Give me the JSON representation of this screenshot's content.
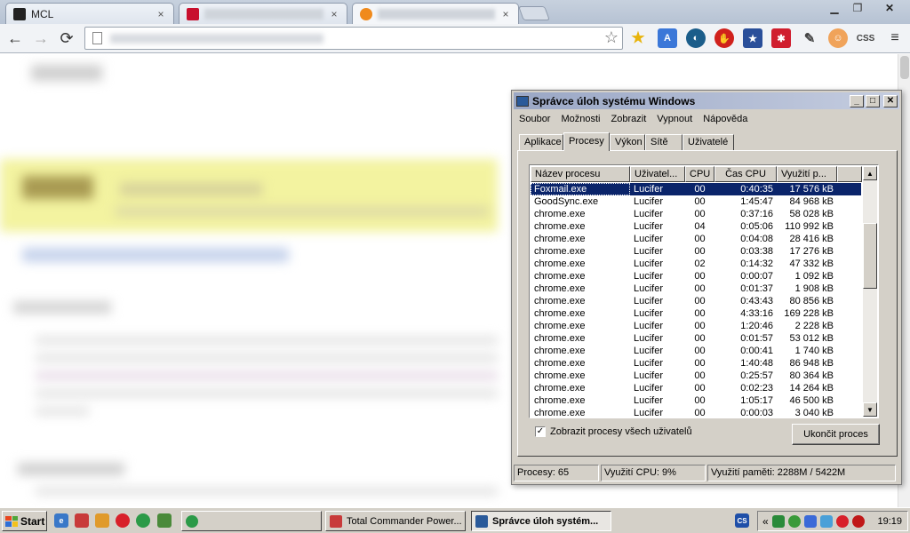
{
  "browser": {
    "tabs": [
      {
        "title": "MCL",
        "icon": "dark-square-icon"
      },
      {
        "title": "",
        "icon": "pnet-favicon"
      },
      {
        "title": "",
        "icon": "fish-favicon"
      }
    ],
    "close_glyph": "×"
  },
  "taskmanager": {
    "title": "Správce úloh systému Windows",
    "menu": [
      "Soubor",
      "Možnosti",
      "Zobrazit",
      "Vypnout",
      "Nápověda"
    ],
    "tabs": [
      "Aplikace",
      "Procesy",
      "Výkon",
      "Sítě",
      "Uživatelé"
    ],
    "active_tab": "Procesy",
    "columns": [
      "Název procesu",
      "Uživatel...",
      "CPU",
      "Čas CPU",
      "Využití p..."
    ],
    "rows": [
      [
        "Foxmail.exe",
        "Lucifer",
        "00",
        "0:40:35",
        "17 576 kB"
      ],
      [
        "GoodSync.exe",
        "Lucifer",
        "00",
        "1:45:47",
        "84 968 kB"
      ],
      [
        "chrome.exe",
        "Lucifer",
        "00",
        "0:37:16",
        "58 028 kB"
      ],
      [
        "chrome.exe",
        "Lucifer",
        "04",
        "0:05:06",
        "110 992 kB"
      ],
      [
        "chrome.exe",
        "Lucifer",
        "00",
        "0:04:08",
        "28 416 kB"
      ],
      [
        "chrome.exe",
        "Lucifer",
        "00",
        "0:03:38",
        "17 276 kB"
      ],
      [
        "chrome.exe",
        "Lucifer",
        "02",
        "0:14:32",
        "47 332 kB"
      ],
      [
        "chrome.exe",
        "Lucifer",
        "00",
        "0:00:07",
        "1 092 kB"
      ],
      [
        "chrome.exe",
        "Lucifer",
        "00",
        "0:01:37",
        "1 908 kB"
      ],
      [
        "chrome.exe",
        "Lucifer",
        "00",
        "0:43:43",
        "80 856 kB"
      ],
      [
        "chrome.exe",
        "Lucifer",
        "00",
        "4:33:16",
        "169 228 kB"
      ],
      [
        "chrome.exe",
        "Lucifer",
        "00",
        "1:20:46",
        "2 228 kB"
      ],
      [
        "chrome.exe",
        "Lucifer",
        "00",
        "0:01:57",
        "53 012 kB"
      ],
      [
        "chrome.exe",
        "Lucifer",
        "00",
        "0:00:41",
        "1 740 kB"
      ],
      [
        "chrome.exe",
        "Lucifer",
        "00",
        "1:40:48",
        "86 948 kB"
      ],
      [
        "chrome.exe",
        "Lucifer",
        "00",
        "0:25:57",
        "80 364 kB"
      ],
      [
        "chrome.exe",
        "Lucifer",
        "00",
        "0:02:23",
        "14 264 kB"
      ],
      [
        "chrome.exe",
        "Lucifer",
        "00",
        "1:05:17",
        "46 500 kB"
      ],
      [
        "chrome.exe",
        "Lucifer",
        "00",
        "0:00:03",
        "3 040 kB"
      ]
    ],
    "selected_row": 0,
    "show_all_label": "Zobrazit procesy všech uživatelů",
    "show_all_checked": true,
    "end_process_label": "Ukončit proces",
    "status": {
      "processes": "Procesy: 65",
      "cpu": "Využití CPU: 9%",
      "memory": "Využití paměti: 2288M / 5422M"
    }
  },
  "taskbar": {
    "start_label": "Start",
    "tasks": [
      {
        "label": "",
        "icon": "chrome-icon"
      },
      {
        "label": "Total Commander Power...",
        "icon": "total-commander-icon"
      },
      {
        "label": "Správce úloh systém...",
        "icon": "task-manager-icon"
      }
    ],
    "tray_lang": "CS",
    "tray_chevron": "«",
    "clock": "19:19"
  },
  "colors": {
    "selection": "#0a246a",
    "window_face": "#d4d0c8",
    "yellow_banner": "#f3f3a0"
  }
}
